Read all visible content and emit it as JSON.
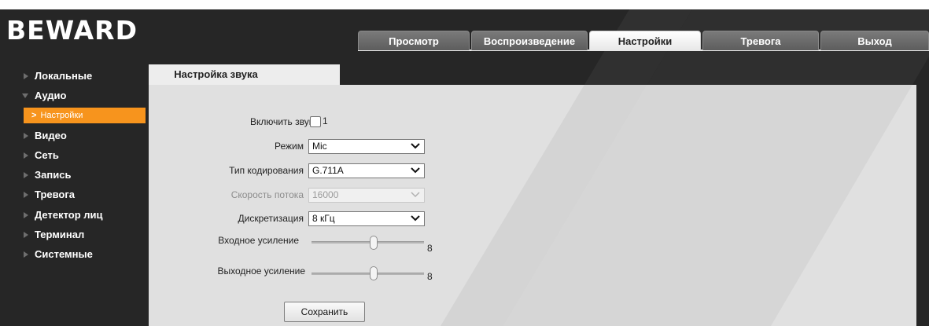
{
  "header": {
    "logo_text": "BEWARD"
  },
  "tabs": [
    {
      "label": "Просмотр",
      "active": false
    },
    {
      "label": "Воспроизведение",
      "active": false
    },
    {
      "label": "Настройки",
      "active": true
    },
    {
      "label": "Тревога",
      "active": false
    },
    {
      "label": "Выход",
      "active": false
    }
  ],
  "sidebar": {
    "items": [
      {
        "label": "Локальные"
      },
      {
        "label": "Аудио",
        "expanded": true
      },
      {
        "label": "Видео"
      },
      {
        "label": "Сеть"
      },
      {
        "label": "Запись"
      },
      {
        "label": "Тревога"
      },
      {
        "label": "Детектор лиц"
      },
      {
        "label": "Терминал"
      },
      {
        "label": "Системные"
      }
    ],
    "active_sub": "Настройки"
  },
  "content": {
    "tab_title": "Настройка звука",
    "enable_sound": {
      "label": "Включить звук",
      "checked": false,
      "channel": "1"
    },
    "mode": {
      "label": "Режим",
      "value": "Mic"
    },
    "encoding": {
      "label": "Тип кодирования",
      "value": "G.711A"
    },
    "bitrate": {
      "label": "Скорость потока",
      "value": "16000",
      "disabled": true
    },
    "sampling": {
      "label": "Дискретизация",
      "value": "8 кГц"
    },
    "input_gain": {
      "label": "Входное усиление",
      "value": "8",
      "level_fraction": 0.55
    },
    "output_gain": {
      "label": "Выходное усиление",
      "value": "8",
      "level_fraction": 0.55
    },
    "save_label": "Сохранить"
  },
  "colors": {
    "background": "#262626",
    "accent": "#f7941d",
    "panel": "#e0e0e0",
    "tab_active": "#ffffff",
    "tab_inactive": "#6b6b6b"
  }
}
